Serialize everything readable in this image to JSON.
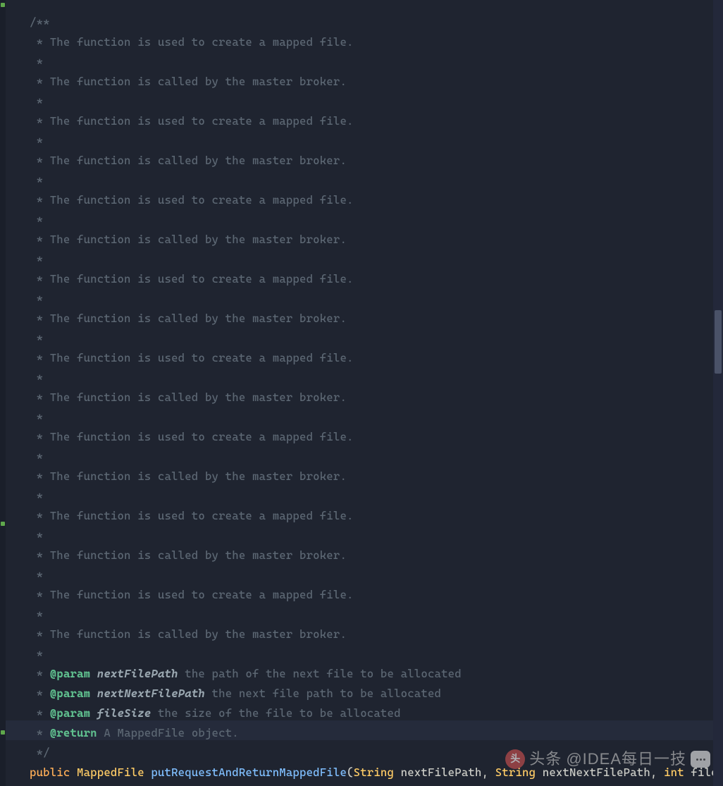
{
  "comment_block": {
    "open": "/**",
    "lines": [
      " * The function is used to create a mapped file.",
      " *",
      " * The function is called by the master broker.",
      " *",
      " * The function is used to create a mapped file.",
      " *",
      " * The function is called by the master broker.",
      " *",
      " * The function is used to create a mapped file.",
      " *",
      " * The function is called by the master broker.",
      " *",
      " * The function is used to create a mapped file.",
      " *",
      " * The function is called by the master broker.",
      " *",
      " * The function is used to create a mapped file.",
      " *",
      " * The function is called by the master broker.",
      " *",
      " * The function is used to create a mapped file.",
      " *",
      " * The function is called by the master broker.",
      " *",
      " * The function is used to create a mapped file.",
      " *",
      " * The function is called by the master broker.",
      " *",
      " * The function is used to create a mapped file.",
      " *",
      " * The function is called by the master broker.",
      " *"
    ],
    "params": [
      {
        "tag": "@param",
        "name": "nextFilePath",
        "desc": " the path of the next file to be allocated"
      },
      {
        "tag": "@param",
        "name": "nextNextFilePath",
        "desc": " the next file path to be allocated"
      },
      {
        "tag": "@param",
        "name": "fileSize",
        "desc": " the size of the file to be allocated"
      }
    ],
    "return": {
      "tag": "@return",
      "desc": " A MappedFile object."
    },
    "close": " */"
  },
  "signature": {
    "modifier": "public",
    "return_type": "MappedFile",
    "method_name": "putRequestAndReturnMappedFile",
    "params": [
      {
        "type": "String",
        "name": "nextFilePath"
      },
      {
        "type": "String",
        "name": "nextNextFilePath"
      },
      {
        "type": "int",
        "name": "fileSize"
      }
    ],
    "fold": "{...}"
  },
  "watermark": {
    "prefix": "头条",
    "handle": "@IDEA每日一技"
  }
}
